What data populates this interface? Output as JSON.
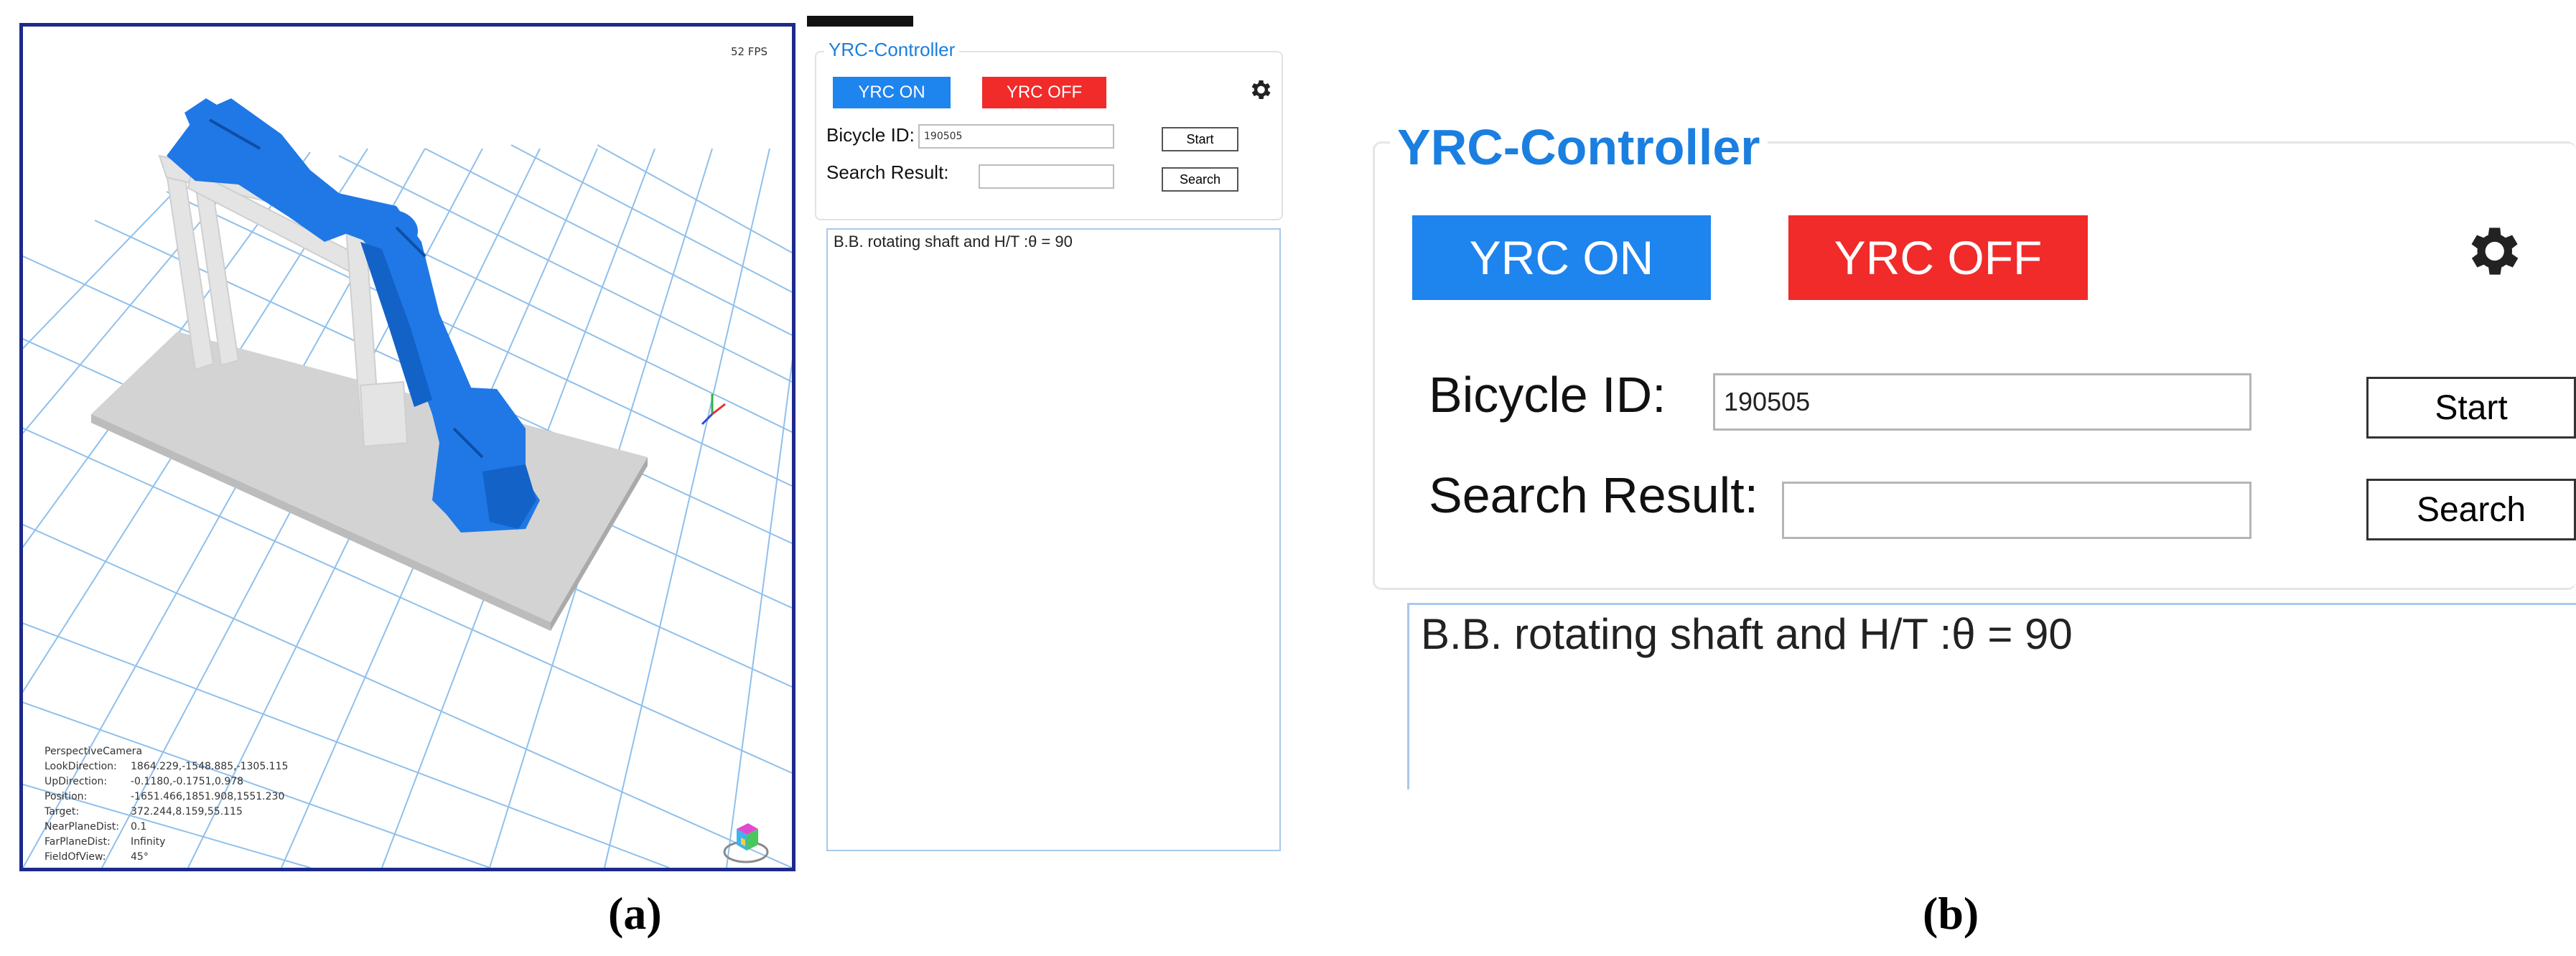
{
  "panel_a": {
    "fps": "52 FPS",
    "camera_info": [
      {
        "key": "PerspectiveCamera",
        "value": ""
      },
      {
        "key": "LookDirection:",
        "value": "1864.229,-1548.885,-1305.115"
      },
      {
        "key": "UpDirection:",
        "value": "-0.1180,-0.1751,0.978"
      },
      {
        "key": "Position:",
        "value": "-1651.466,1851.908,1551.230"
      },
      {
        "key": "Target:",
        "value": "372.244,8.159,55.115"
      },
      {
        "key": "NearPlaneDist:",
        "value": "0.1"
      },
      {
        "key": "FarPlaneDist:",
        "value": "Infinity"
      },
      {
        "key": "FieldOfView:",
        "value": "45°"
      }
    ],
    "controller": {
      "title": "YRC-Controller",
      "on_label": "YRC ON",
      "off_label": "YRC OFF",
      "bicycle_id_label": "Bicycle ID:",
      "bicycle_id_value": "190505",
      "start_label": "Start",
      "search_result_label": "Search Result:",
      "search_result_value": "",
      "search_label": "Search",
      "result_text": "B.B. rotating shaft and H/T :θ = 90"
    }
  },
  "panel_b": {
    "controller": {
      "title": "YRC-Controller",
      "on_label": "YRC ON",
      "off_label": "YRC OFF",
      "bicycle_id_label": "Bicycle ID:",
      "bicycle_id_value": "190505",
      "start_label": "Start",
      "search_result_label": "Search Result:",
      "search_result_value": "",
      "search_label": "Search",
      "result_text": "B.B. rotating shaft and H/T :θ = 90"
    }
  },
  "captions": {
    "a": "(a)",
    "b": "(b)"
  },
  "colors": {
    "accent_blue": "#1a7fe0",
    "on_button": "#1e84ee",
    "off_button": "#f12a2a",
    "viewport_border": "#1c2a8a",
    "robot": "#1f78e6",
    "grid": "#8fc0ec"
  },
  "icons": {
    "settings": "gear-icon",
    "view_cube": "view-cube-icon",
    "axis_gizmo": "axis-gizmo-icon"
  }
}
